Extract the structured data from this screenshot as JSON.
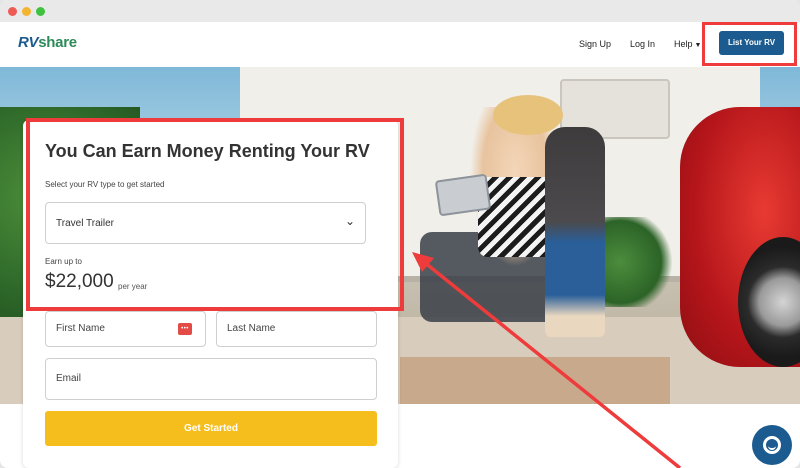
{
  "header": {
    "logo_rv": "RV",
    "logo_share": "share",
    "nav": {
      "signup": "Sign Up",
      "login": "Log In",
      "help": "Help"
    },
    "list_your_rv": "List Your RV"
  },
  "card": {
    "title": "You Can Earn Money Renting Your RV",
    "subtitle": "Select your RV type to get started",
    "rv_type_selected": "Travel Trailer",
    "earn_label": "Earn up to",
    "earn_amount": "$22,000",
    "earn_unit": "per year",
    "first_name_placeholder": "First Name",
    "last_name_placeholder": "Last Name",
    "email_placeholder": "Email",
    "password_icon_text": "•••",
    "cta": "Get Started"
  },
  "colors": {
    "brand_blue": "#1b5b8f",
    "brand_green": "#2f8a5b",
    "cta_yellow": "#f6be1d",
    "annotation_red": "#ee3b3b"
  },
  "icons": [
    "chevron-down-icon",
    "password-dots-icon",
    "chat-bubble-icon"
  ]
}
